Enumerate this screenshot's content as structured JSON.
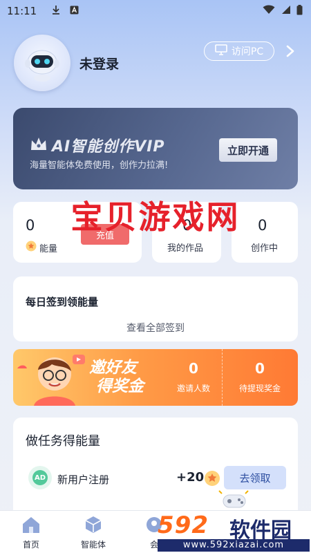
{
  "status_bar": {
    "time": "11:11",
    "icons": [
      "download-icon",
      "a-icon",
      "wifi-icon",
      "signal-icon",
      "battery-icon"
    ]
  },
  "profile": {
    "username": "未登录",
    "visit_pc_label": "访问PC"
  },
  "vip": {
    "title": "AI智能创作VIP",
    "subtitle": "海量智能体免费使用，创作力拉满!",
    "button_label": "立即开通"
  },
  "stats": [
    {
      "value": "0",
      "label": "能量"
    },
    {
      "value": "0",
      "label": "我的作品"
    },
    {
      "value": "0",
      "label": "创作中"
    }
  ],
  "stats_chip_label": "充值",
  "signin": {
    "title": "每日签到领能量",
    "link": "查看全部签到"
  },
  "invite": {
    "title_line1": "邀好友",
    "title_line2": "得奖金",
    "stats": [
      {
        "value": "0",
        "label": "邀请人数"
      },
      {
        "value": "0",
        "label": "待提现奖金"
      }
    ]
  },
  "tasks": {
    "title": "做任务得能量",
    "items": [
      {
        "name": "新用户注册",
        "reward": "+20",
        "button": "去领取",
        "icon_text": "AD"
      }
    ]
  },
  "bottom_nav": [
    {
      "label": "首页",
      "icon": "home-icon"
    },
    {
      "label": "智能体",
      "icon": "cube-icon"
    },
    {
      "label": "会",
      "icon": "member-icon"
    }
  ],
  "watermark": {
    "top_text": "宝贝游戏网",
    "brand_num": "592",
    "brand_text": "软件园",
    "url": "www.592xiazai.com"
  },
  "colors": {
    "accent_blue": "#2d4ea0",
    "vip_dark": "#3b4a6e",
    "invite_orange": "#ff9a46",
    "watermark_red": "#e6212b"
  }
}
